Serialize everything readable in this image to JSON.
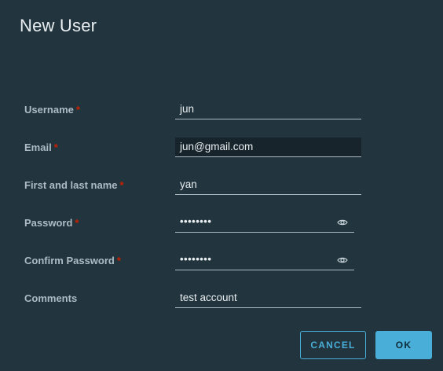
{
  "dialog": {
    "title": "New User"
  },
  "form": {
    "username": {
      "label": "Username",
      "required_mark": "*",
      "value": "jun"
    },
    "email": {
      "label": "Email",
      "required_mark": "*",
      "value": "jun@gmail.com"
    },
    "full_name": {
      "label": "First and last name",
      "required_mark": "*",
      "value": "yan"
    },
    "password": {
      "label": "Password",
      "required_mark": "*",
      "value": "••••••••",
      "toggle_icon": "eye-icon"
    },
    "confirm_password": {
      "label": "Confirm Password",
      "required_mark": "*",
      "value": "••••••••",
      "toggle_icon": "eye-icon"
    },
    "comments": {
      "label": "Comments",
      "value": "test account"
    }
  },
  "buttons": {
    "cancel": "CANCEL",
    "ok": "OK"
  },
  "colors": {
    "background": "#22343d",
    "accent": "#49afd9",
    "required": "#c92100"
  }
}
